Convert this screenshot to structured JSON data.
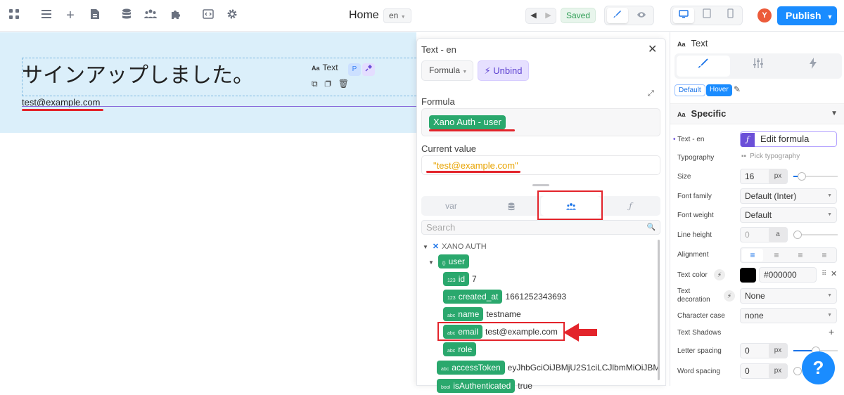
{
  "topbar": {
    "page_title": "Home",
    "language": "en",
    "status": "Saved",
    "avatar_initial": "Y",
    "publish_label": "Publish"
  },
  "canvas": {
    "heading": "サインアップしました。",
    "email_text": "test@example.com",
    "element_tag": {
      "label": "Text",
      "badge": "P"
    }
  },
  "formula_panel": {
    "title": "Text - en",
    "mode_select": "Formula",
    "unbind_label": "Unbind",
    "formula_label": "Formula",
    "formula_chip": "Xano Auth - user",
    "current_value_label": "Current value",
    "current_value": "\"test@example.com\"",
    "tabs": [
      {
        "label": "var",
        "active": false
      },
      {
        "label": "",
        "icon": "database-icon",
        "active": false
      },
      {
        "label": "",
        "icon": "users-icon",
        "active": true
      },
      {
        "label": "",
        "icon": "function-icon",
        "active": false
      }
    ],
    "search_placeholder": "Search",
    "tree": {
      "section": "XANO AUTH",
      "user_label": "user",
      "fields": [
        {
          "type": "123",
          "name": "id",
          "value": "7"
        },
        {
          "type": "123",
          "name": "created_at",
          "value": "1661252343693"
        },
        {
          "type": "abc",
          "name": "name",
          "value": "testname"
        },
        {
          "type": "abc",
          "name": "email",
          "value": "test@example.com"
        },
        {
          "type": "abc",
          "name": "role",
          "value": ""
        }
      ],
      "access_token": {
        "type": "abc",
        "name": "accessToken",
        "value": "eyJhbGciOiJBMjU2S1ciLCJlbmMiOiJBM..."
      },
      "is_authenticated": {
        "type": "bool",
        "name": "isAuthenticated",
        "value": "true"
      }
    }
  },
  "right_panel": {
    "header": "Text",
    "states": [
      "Default",
      "Hover"
    ],
    "section": "Specific",
    "props": {
      "text_label": "Text - en",
      "edit_formula": "Edit formula",
      "typography_label": "Typography",
      "typography_value": "Pick typography",
      "size_label": "Size",
      "size_value": "16",
      "size_unit": "px",
      "font_family_label": "Font family",
      "font_family_value": "Default (Inter)",
      "font_weight_label": "Font weight",
      "font_weight_value": "Default",
      "line_height_label": "Line height",
      "line_height_value": "0",
      "line_height_unit": "a",
      "alignment_label": "Alignment",
      "text_color_label": "Text color",
      "text_color_value": "#000000",
      "text_decoration_label": "Text decoration",
      "text_decoration_value": "None",
      "character_case_label": "Character case",
      "character_case_value": "none",
      "text_shadows_label": "Text Shadows",
      "letter_spacing_label": "Letter spacing",
      "letter_spacing_value": "0",
      "letter_spacing_unit": "px",
      "word_spacing_label": "Word spacing",
      "word_spacing_value": "0",
      "word_spacing_unit": "px"
    }
  },
  "help_label": "?",
  "colors": {
    "accent": "#1a8cff",
    "chip_green": "#2aa86d",
    "highlight_red": "#e3242b",
    "hero_bg": "#dbeffa"
  }
}
